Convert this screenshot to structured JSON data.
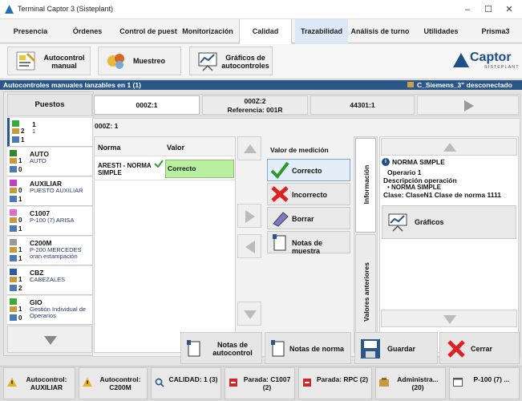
{
  "window": {
    "title": "Terminal Captor 3 (Sisteplant)",
    "minimize": "–",
    "maximize": "☐",
    "close": "✕"
  },
  "menu": {
    "tabs": [
      "Presencia",
      "Órdenes",
      "Control de puest",
      "Monitorización",
      "Calidad",
      "Trazabilidad",
      "Análisis de turno",
      "Utilidades",
      "Prisma3"
    ]
  },
  "toolbar": {
    "autocontrol_manual": "Autocontrol manual",
    "muestreo": "Muestreo",
    "graficos_autocontroles": "Gráficos de autocontroles",
    "logo_text": "Captor",
    "logo_sub": "SISTEPLANT"
  },
  "status": {
    "left": "Autocontroles manuales lanzables en 1 (1)",
    "right": "C_Siemens_3\" desconectado"
  },
  "puestos": {
    "header": "Puestos",
    "items": [
      {
        "name": "1",
        "count": "2",
        "sub": "1",
        "bottom": "1",
        "color": "#3aaa3a"
      },
      {
        "name": "AUTO",
        "count": "1",
        "sub": "AUTO",
        "bottom": "0",
        "color": "#2b8a2b"
      },
      {
        "name": "AUXILIAR",
        "count": "0",
        "sub": "PUESTO AUXILIAR",
        "bottom": "1",
        "color": "#c040c0"
      },
      {
        "name": "C1007",
        "count": "0",
        "sub": "P-100 (7) ARISA",
        "bottom": "1",
        "color": "#e06ad0"
      },
      {
        "name": "C200M",
        "count": "1",
        "sub": "P-200 MERCEDES oran estampación",
        "bottom": "1",
        "color": "#999999"
      },
      {
        "name": "CBZ",
        "count": "1",
        "sub": "CABEZALES",
        "bottom": "2",
        "color": "#2a5aa8"
      },
      {
        "name": "GIO",
        "count": "1",
        "sub": "Gestión Individual de Operarios",
        "bottom": "0",
        "color": "#3aaa3a"
      }
    ]
  },
  "order_tabs": [
    {
      "line1": "000Z:1",
      "line2": ""
    },
    {
      "line1": "000Z:2",
      "line2": "Referencia: 001R"
    },
    {
      "line1": "44301:1",
      "line2": ""
    }
  ],
  "grid": {
    "title": "000Z: 1",
    "col_norma": "Norma",
    "col_valor": "Valor",
    "row_norma": "ARESTI - NORMA SIMPLE",
    "row_valor": "Correcto"
  },
  "medicion": {
    "title": "Valor de medición",
    "correcto": "Correcto",
    "incorrecto": "Incorrecto",
    "borrar": "Borrar",
    "notas_muestra": "Notas de muestra"
  },
  "side_tabs": {
    "informacion": "Información",
    "valores_anteriores": "Valores anteriores"
  },
  "info": {
    "title": "NORMA SIMPLE",
    "operario": "Operario 1",
    "desc_label": "Descripción operación",
    "desc_value": "• NORMA SIMPLE",
    "clase": "Clase: ClaseN1 Clase de norma 1111",
    "graficos": "Gráficos"
  },
  "actions": {
    "notas_autocontrol": "Notas de autocontrol",
    "notas_norma": "Notas de norma",
    "guardar": "Guardar",
    "cerrar": "Cerrar"
  },
  "bottom_tabs": [
    {
      "label": "Autocontrol: AUXILIAR",
      "icon": "warning-icon"
    },
    {
      "label": "Autocontrol: C200M",
      "icon": "warning-icon"
    },
    {
      "label": "CALIDAD: 1 (3)",
      "icon": "search-icon"
    },
    {
      "label": "Parada: C1007 (2)",
      "icon": "stop-icon"
    },
    {
      "label": "Parada: RPC (2)",
      "icon": "stop-icon"
    },
    {
      "label": "Administra... (20)",
      "icon": "admin-icon"
    },
    {
      "label": "P-100 (7) ...",
      "icon": "window-icon"
    }
  ],
  "colors": {
    "accent": "#2b5788",
    "green": "#b9f0a0",
    "red": "#e02020"
  }
}
